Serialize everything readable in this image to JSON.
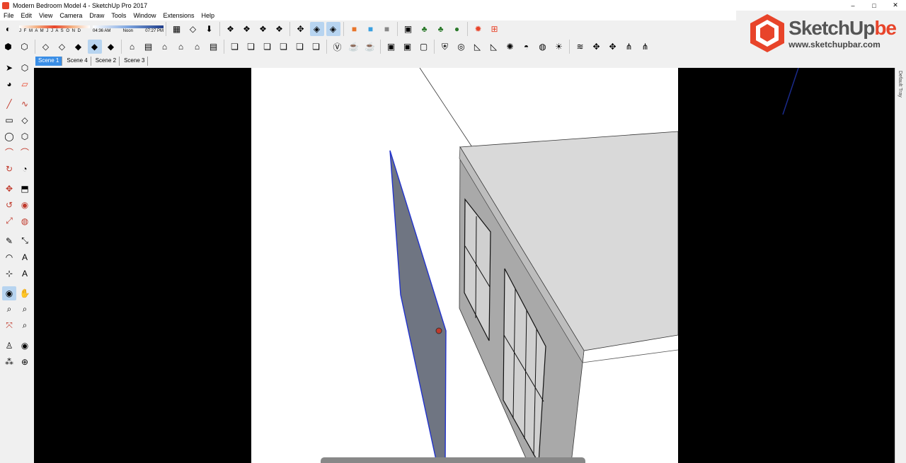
{
  "window": {
    "title": "Modern Bedroom Model 4 - SketchUp Pro 2017",
    "controls": [
      "–",
      "□",
      "✕"
    ]
  },
  "menu": [
    "File",
    "Edit",
    "View",
    "Camera",
    "Draw",
    "Tools",
    "Window",
    "Extensions",
    "Help"
  ],
  "shadow": {
    "months": "J F M A M J J A S O N D",
    "time_start": "04:36 AM",
    "time_mid": "Noon",
    "time_end": "07:27 PM"
  },
  "scenes": [
    "Scene 1",
    "Scene 4",
    "Scene 2",
    "Scene 3"
  ],
  "active_scene": "Scene 1",
  "tray": {
    "label": "Default Tray"
  },
  "logo": {
    "name_main": "SketchUp",
    "name_accent": "be",
    "url": "www.sketchupbar.com"
  },
  "colors": {
    "accent_red": "#e8442a",
    "selection_blue": "#2233cc",
    "active_tab": "#3a8ee6"
  }
}
